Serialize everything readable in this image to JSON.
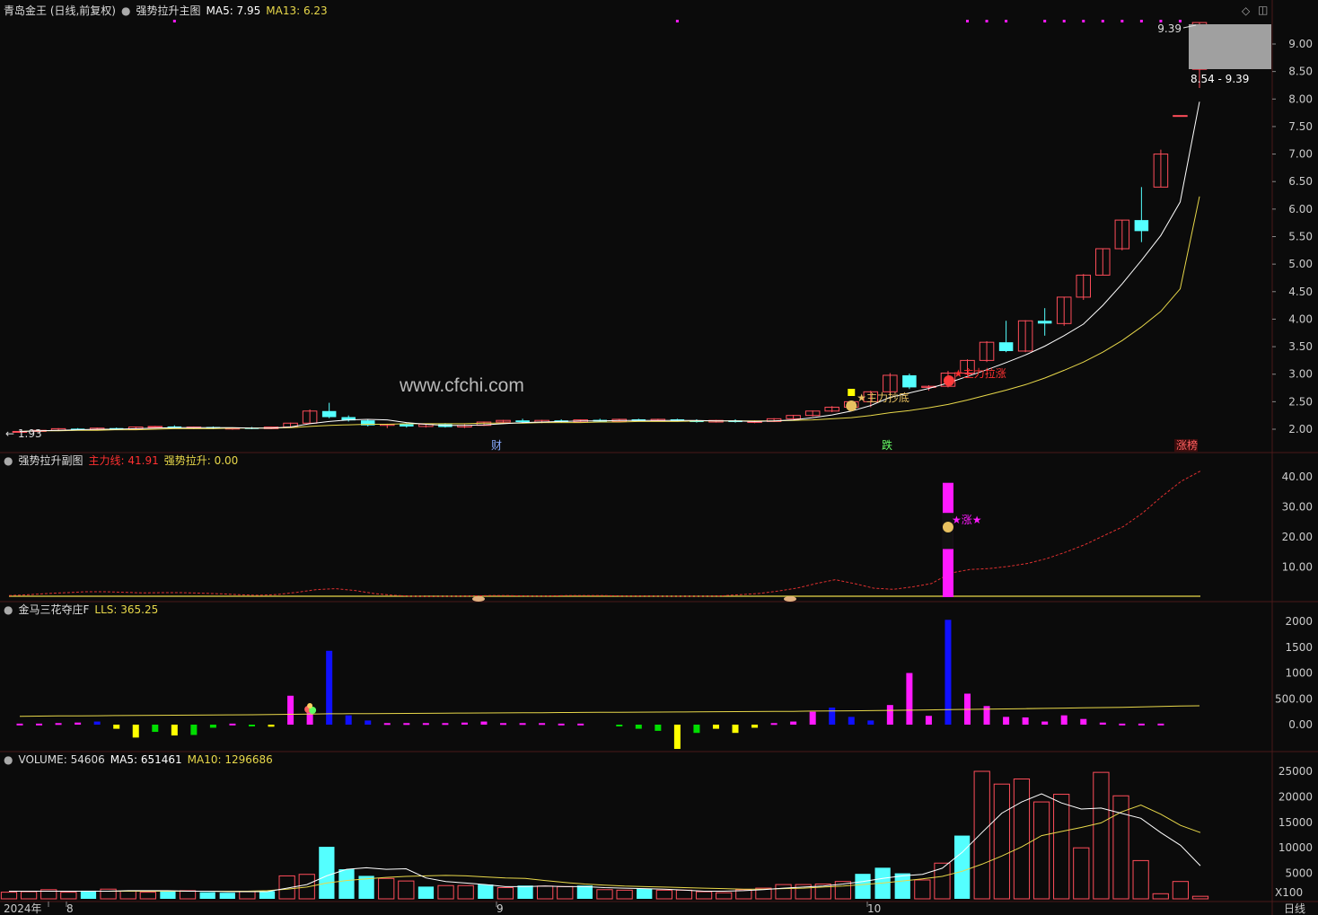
{
  "colors": {
    "bg": "#0b0b0b",
    "grid": "#4a1a1a",
    "up": "#ff4d5a",
    "down": "#54ffff",
    "ma_white": "#ffffff",
    "ma_yellow": "#e8d84a",
    "magenta": "#ff1aff",
    "blue": "#1010ff",
    "yellow": "#ffff00",
    "green": "#00dd00",
    "axis_text": "#cccccc",
    "red_text": "#ff3030"
  },
  "header": {
    "stock_name": "青岛金王 (日线,前复权)",
    "indicator_name": "强势拉升主图",
    "ma5_label": "MA5: 7.95",
    "ma13_label": "MA13: 6.23"
  },
  "panel2": {
    "title": "强势拉升副图",
    "line1": "主力线: 41.91",
    "line2": "强势拉升: 0.00"
  },
  "panel3": {
    "title": "金马三花夺庄F",
    "line1": "LLS: 365.25"
  },
  "panel4": {
    "title": "VOLUME: 54606",
    "ma5": "MA5: 651461",
    "ma10": "MA10: 1296686"
  },
  "watermark": "www.cfchi.com",
  "annotations": {
    "low_label": "← 1.93",
    "high_label": "9.39",
    "range_label": "8.54 - 9.39",
    "zhuli_chaodi": "★主力抄底",
    "zhuli_lazhang": "★主力拉涨",
    "zhang_star": "★涨★",
    "cai": "财",
    "die": "跌",
    "zhangting": "涨榜"
  },
  "axes": {
    "price_ticks": [
      "9.00",
      "8.50",
      "8.00",
      "7.50",
      "7.00",
      "6.50",
      "6.00",
      "5.50",
      "5.00",
      "4.50",
      "4.00",
      "3.50",
      "3.00",
      "2.50",
      "2.00"
    ],
    "sub_ticks": [
      "40.00",
      "30.00",
      "20.00",
      "10.00"
    ],
    "lls_ticks": [
      "2000",
      "1500",
      "1000",
      "500.00",
      "0.00"
    ],
    "vol_ticks": [
      "25000",
      "20000",
      "15000",
      "10000",
      "5000"
    ],
    "vol_unit": "X100",
    "x_labels": [
      "2024年",
      "8",
      "9",
      "10"
    ],
    "period": "日线"
  },
  "chart_data": {
    "type": "candlestick",
    "title": "青岛金王 (日线,前复权)",
    "xlabel": "",
    "ylabel": "",
    "ylim": [
      1.8,
      9.45
    ],
    "x_labels": [
      "2024年",
      "8",
      "9",
      "10"
    ],
    "candles": [
      [
        1.95,
        1.97,
        1.93,
        1.96
      ],
      [
        1.96,
        1.99,
        1.95,
        1.98
      ],
      [
        1.98,
        2.02,
        1.97,
        2.01
      ],
      [
        2.01,
        2.02,
        1.98,
        1.99
      ],
      [
        1.99,
        2.03,
        1.98,
        2.02
      ],
      [
        2.02,
        2.03,
        1.99,
        2.0
      ],
      [
        2.0,
        2.05,
        1.99,
        2.04
      ],
      [
        2.04,
        2.06,
        2.02,
        2.05
      ],
      [
        2.05,
        2.07,
        2.01,
        2.02
      ],
      [
        2.02,
        2.05,
        2.0,
        2.04
      ],
      [
        2.04,
        2.05,
        2.0,
        2.01
      ],
      [
        2.01,
        2.03,
        1.99,
        2.02
      ],
      [
        2.02,
        2.04,
        2.0,
        2.01
      ],
      [
        2.01,
        2.05,
        2.0,
        2.04
      ],
      [
        2.04,
        2.12,
        2.03,
        2.11
      ],
      [
        2.11,
        2.36,
        2.1,
        2.33
      ],
      [
        2.33,
        2.48,
        2.2,
        2.22
      ],
      [
        2.22,
        2.25,
        2.14,
        2.16
      ],
      [
        2.16,
        2.18,
        2.05,
        2.07
      ],
      [
        2.07,
        2.1,
        2.02,
        2.09
      ],
      [
        2.09,
        2.11,
        2.03,
        2.05
      ],
      [
        2.05,
        2.1,
        2.03,
        2.09
      ],
      [
        2.09,
        2.11,
        2.03,
        2.04
      ],
      [
        2.04,
        2.09,
        2.02,
        2.07
      ],
      [
        2.07,
        2.14,
        2.06,
        2.13
      ],
      [
        2.13,
        2.17,
        2.1,
        2.16
      ],
      [
        2.16,
        2.19,
        2.12,
        2.13
      ],
      [
        2.13,
        2.17,
        2.11,
        2.16
      ],
      [
        2.16,
        2.18,
        2.12,
        2.13
      ],
      [
        2.13,
        2.18,
        2.12,
        2.17
      ],
      [
        2.17,
        2.19,
        2.13,
        2.14
      ],
      [
        2.14,
        2.19,
        2.13,
        2.18
      ],
      [
        2.18,
        2.19,
        2.14,
        2.15
      ],
      [
        2.15,
        2.19,
        2.14,
        2.18
      ],
      [
        2.18,
        2.19,
        2.14,
        2.15
      ],
      [
        2.15,
        2.18,
        2.12,
        2.13
      ],
      [
        2.13,
        2.17,
        2.12,
        2.16
      ],
      [
        2.16,
        2.18,
        2.12,
        2.13
      ],
      [
        2.13,
        2.16,
        2.11,
        2.14
      ],
      [
        2.14,
        2.2,
        2.13,
        2.19
      ],
      [
        2.19,
        2.26,
        2.18,
        2.25
      ],
      [
        2.25,
        2.34,
        2.23,
        2.33
      ],
      [
        2.33,
        2.42,
        2.31,
        2.4
      ],
      [
        2.4,
        2.52,
        2.38,
        2.5
      ],
      [
        2.5,
        2.7,
        2.4,
        2.68
      ],
      [
        2.68,
        3.02,
        2.62,
        2.98
      ],
      [
        2.98,
        3.01,
        2.73,
        2.76
      ],
      [
        2.76,
        2.8,
        2.7,
        2.78
      ],
      [
        2.78,
        3.06,
        2.76,
        3.02
      ],
      [
        3.02,
        3.27,
        2.98,
        3.25
      ],
      [
        3.25,
        3.6,
        3.22,
        3.58
      ],
      [
        3.58,
        3.97,
        3.4,
        3.42
      ],
      [
        3.42,
        3.98,
        3.4,
        3.97
      ],
      [
        3.97,
        4.2,
        3.7,
        3.92
      ],
      [
        3.92,
        4.4,
        3.88,
        4.4
      ],
      [
        4.4,
        4.82,
        4.35,
        4.8
      ],
      [
        4.8,
        5.28,
        4.8,
        5.28
      ],
      [
        5.28,
        5.8,
        5.25,
        5.8
      ],
      [
        5.8,
        6.4,
        5.4,
        5.6
      ],
      [
        6.4,
        7.08,
        6.4,
        7.0
      ],
      [
        7.7,
        7.7,
        7.7,
        7.7
      ],
      [
        8.54,
        9.39,
        8.2,
        9.39
      ]
    ],
    "ma5": [
      1.96,
      1.97,
      1.98,
      1.99,
      2.0,
      2.0,
      2.01,
      2.02,
      2.03,
      2.03,
      2.03,
      2.03,
      2.02,
      2.02,
      2.04,
      2.1,
      2.14,
      2.17,
      2.18,
      2.17,
      2.12,
      2.09,
      2.07,
      2.07,
      2.08,
      2.1,
      2.12,
      2.13,
      2.14,
      2.15,
      2.15,
      2.16,
      2.16,
      2.16,
      2.16,
      2.16,
      2.15,
      2.15,
      2.14,
      2.15,
      2.17,
      2.21,
      2.26,
      2.33,
      2.43,
      2.58,
      2.66,
      2.74,
      2.84,
      2.96,
      3.08,
      3.21,
      3.35,
      3.51,
      3.7,
      3.91,
      4.25,
      4.64,
      5.07,
      5.52,
      6.13,
      7.95
    ],
    "ma13": [
      1.96,
      1.97,
      1.97,
      1.98,
      1.98,
      1.99,
      1.99,
      2.0,
      2.01,
      2.01,
      2.01,
      2.02,
      2.02,
      2.02,
      2.03,
      2.05,
      2.07,
      2.08,
      2.09,
      2.09,
      2.1,
      2.1,
      2.1,
      2.1,
      2.11,
      2.11,
      2.11,
      2.12,
      2.12,
      2.12,
      2.13,
      2.13,
      2.14,
      2.14,
      2.14,
      2.15,
      2.15,
      2.15,
      2.15,
      2.15,
      2.16,
      2.17,
      2.19,
      2.21,
      2.25,
      2.3,
      2.34,
      2.39,
      2.45,
      2.53,
      2.62,
      2.71,
      2.81,
      2.93,
      3.07,
      3.22,
      3.4,
      3.61,
      3.86,
      4.14,
      4.55,
      6.23
    ],
    "sub_main_line": [
      0.5,
      0.8,
      1.2,
      1.5,
      1.8,
      1.8,
      1.6,
      1.4,
      1.5,
      1.5,
      1.3,
      1.1,
      0.8,
      0.6,
      0.9,
      1.6,
      2.5,
      2.8,
      2.2,
      1.2,
      0.6,
      0.3,
      0.2,
      0.3,
      0.4,
      0.5,
      0.5,
      0.4,
      0.4,
      0.5,
      0.5,
      0.5,
      0.4,
      0.4,
      0.3,
      0.3,
      0.3,
      0.4,
      0.8,
      1.2,
      2.0,
      3.0,
      4.5,
      5.8,
      4.5,
      3.0,
      2.6,
      3.4,
      4.5,
      8.0,
      9.2,
      9.5,
      10.2,
      11.2,
      12.8,
      15.0,
      17.5,
      20.5,
      23.5,
      28.0,
      33.5,
      38.5,
      41.91
    ],
    "sub_bar_index": 48,
    "sub_bar_value": 38,
    "lls_line": [
      160,
      165,
      168,
      170,
      172,
      175,
      178,
      180,
      182,
      185,
      188,
      190,
      192,
      195,
      200,
      205,
      210,
      212,
      214,
      216,
      218,
      220,
      222,
      224,
      226,
      228,
      230,
      232,
      234,
      236,
      238,
      240,
      242,
      244,
      246,
      248,
      250,
      252,
      254,
      256,
      258,
      262,
      265,
      268,
      272,
      276,
      280,
      285,
      290,
      295,
      300,
      305,
      310,
      315,
      320,
      325,
      330,
      335,
      345,
      352,
      360,
      365.25
    ],
    "lls_bars": [
      [
        0,
        "m",
        20
      ],
      [
        1,
        "m",
        20
      ],
      [
        2,
        "m",
        30
      ],
      [
        3,
        "m",
        40
      ],
      [
        4,
        "b",
        60
      ],
      [
        5,
        "y",
        -80
      ],
      [
        6,
        "y",
        -250
      ],
      [
        7,
        "g",
        -140
      ],
      [
        8,
        "y",
        -210
      ],
      [
        9,
        "g",
        -200
      ],
      [
        10,
        "g",
        -60
      ],
      [
        11,
        "m",
        20
      ],
      [
        12,
        "g",
        -30
      ],
      [
        13,
        "y",
        -40
      ],
      [
        14,
        "m",
        560
      ],
      [
        15,
        "m",
        300
      ],
      [
        16,
        "b",
        1430
      ],
      [
        17,
        "b",
        180
      ],
      [
        18,
        "b",
        80
      ],
      [
        19,
        "m",
        30
      ],
      [
        20,
        "m",
        30
      ],
      [
        21,
        "m",
        30
      ],
      [
        22,
        "m",
        30
      ],
      [
        23,
        "m",
        40
      ],
      [
        24,
        "m",
        60
      ],
      [
        25,
        "m",
        30
      ],
      [
        26,
        "m",
        30
      ],
      [
        27,
        "m",
        30
      ],
      [
        28,
        "m",
        20
      ],
      [
        29,
        "m",
        20
      ],
      [
        31,
        "g",
        -20
      ],
      [
        32,
        "g",
        -80
      ],
      [
        33,
        "g",
        -120
      ],
      [
        34,
        "y",
        -470
      ],
      [
        35,
        "g",
        -160
      ],
      [
        36,
        "y",
        -80
      ],
      [
        37,
        "y",
        -160
      ],
      [
        38,
        "y",
        -60
      ],
      [
        39,
        "m",
        30
      ],
      [
        40,
        "m",
        60
      ],
      [
        41,
        "m",
        250
      ],
      [
        42,
        "b",
        330
      ],
      [
        43,
        "b",
        150
      ],
      [
        44,
        "b",
        80
      ],
      [
        45,
        "m",
        380
      ],
      [
        46,
        "m",
        1000
      ],
      [
        47,
        "m",
        170
      ],
      [
        48,
        "b",
        2030
      ],
      [
        49,
        "m",
        600
      ],
      [
        50,
        "m",
        360
      ],
      [
        51,
        "m",
        150
      ],
      [
        52,
        "m",
        140
      ],
      [
        53,
        "m",
        60
      ],
      [
        54,
        "m",
        180
      ],
      [
        55,
        "m",
        110
      ],
      [
        56,
        "m",
        40
      ],
      [
        57,
        "m",
        20
      ],
      [
        58,
        "m",
        20
      ],
      [
        59,
        "m",
        20
      ]
    ],
    "volume": [
      1300,
      1400,
      1800,
      1300,
      1600,
      1900,
      1500,
      1300,
      1600,
      1600,
      1300,
      1200,
      1400,
      1500,
      4500,
      4800,
      10200,
      5800,
      4500,
      4000,
      3500,
      2400,
      2600,
      2600,
      2800,
      2200,
      2600,
      2500,
      2400,
      2600,
      1800,
      1700,
      2000,
      1700,
      1700,
      1400,
      1200,
      1800,
      2100,
      2800,
      2800,
      2900,
      3400,
      4900,
      6100,
      5000,
      3700,
      7000,
      12400,
      25000,
      22500,
      23500,
      19000,
      20500,
      10000,
      24800,
      20200,
      7500,
      1000,
      3400,
      500
    ],
    "vol_up": [
      1,
      1,
      1,
      1,
      0,
      1,
      1,
      1,
      0,
      1,
      0,
      0,
      1,
      0,
      1,
      1,
      0,
      0,
      0,
      1,
      1,
      0,
      1,
      1,
      0,
      1,
      0,
      1,
      1,
      0,
      1,
      1,
      0,
      1,
      1,
      1,
      1,
      1,
      1,
      1,
      1,
      1,
      1,
      0,
      0,
      0,
      1,
      1,
      0,
      1,
      1,
      1,
      1,
      1,
      1,
      1,
      1,
      1,
      1,
      1
    ],
    "vol_ma5": [
      1500,
      1500,
      1500,
      1500,
      1500,
      1500,
      1600,
      1600,
      1600,
      1500,
      1500,
      1400,
      1400,
      1400,
      2100,
      2800,
      4500,
      5800,
      6100,
      5800,
      5900,
      4100,
      3400,
      3100,
      2800,
      2400,
      2400,
      2500,
      2400,
      2400,
      2200,
      2100,
      2000,
      1900,
      1700,
      1500,
      1500,
      1600,
      1800,
      2100,
      2300,
      2500,
      2900,
      3400,
      4000,
      4500,
      4800,
      6000,
      9100,
      13000,
      16800,
      19000,
      20600,
      18800,
      17600,
      17800,
      16800,
      15800,
      13000,
      10500,
      6500
    ],
    "vol_ma10": [
      1500,
      1500,
      1500,
      1500,
      1500,
      1500,
      1500,
      1500,
      1500,
      1500,
      1500,
      1500,
      1500,
      1600,
      1900,
      2300,
      3100,
      3600,
      3900,
      4200,
      4400,
      4500,
      4600,
      4500,
      4300,
      4100,
      4000,
      3600,
      3200,
      2900,
      2700,
      2500,
      2400,
      2300,
      2200,
      2100,
      2000,
      1900,
      1900,
      2000,
      2100,
      2300,
      2500,
      2800,
      3100,
      3500,
      3900,
      4400,
      5400,
      6800,
      8400,
      10200,
      12400,
      13200,
      14000,
      14900,
      17000,
      18400,
      16600,
      14400,
      13000
    ]
  }
}
